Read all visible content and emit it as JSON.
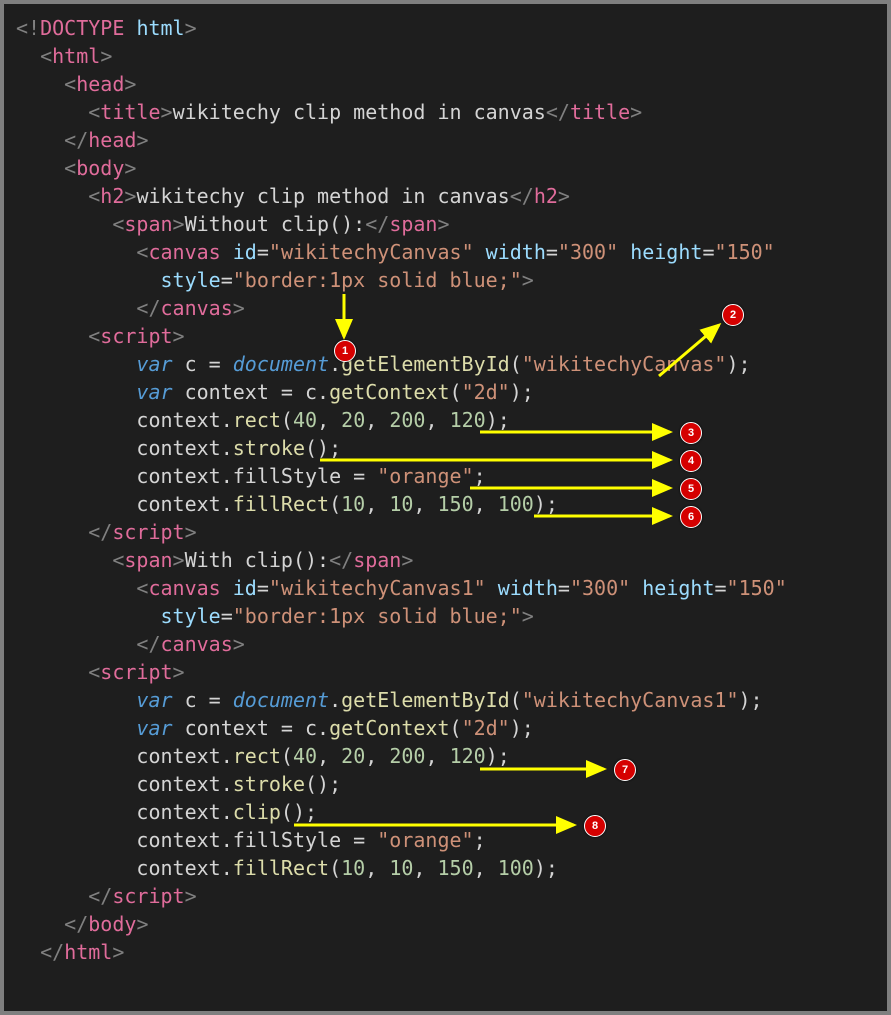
{
  "code_lines": {
    "l1": "<!DOCTYPE html>",
    "l2": "<html>",
    "l3": "<head>",
    "l4a": "<title>",
    "l4b": "wikitechy clip method in canvas",
    "l4c": "</title>",
    "l5": "</head>",
    "l6": "<body>",
    "l7a": "<h2>",
    "l7b": "wikitechy clip method in canvas",
    "l7c": "</h2>",
    "l8a": "<span>",
    "l8b": "Without clip():",
    "l8c": "</span>",
    "l9_tag": "canvas",
    "l9_id": "\"wikitechyCanvas\"",
    "l9_w": "\"300\"",
    "l9_h": "\"150\"",
    "l10_style": "\"border:1px solid blue;\"",
    "l11": "</canvas>",
    "l12": "<script>",
    "l13_var": "var",
    "l13_c": " c = ",
    "l13_doc": "document",
    "l13_fn": "getElementById",
    "l13_arg": "\"wikitechyCanvas\"",
    "l14_var": "var",
    "l14_rest": " context = c.",
    "l14_fn": "getContext",
    "l14_arg": "\"2d\"",
    "l15_pre": "context.",
    "l15_fn": "rect",
    "l15_args": [
      "40",
      "20",
      "200",
      "120"
    ],
    "l16_pre": "context.",
    "l16_fn": "stroke",
    "l17_pre": "context.fillStyle = ",
    "l17_str": "\"orange\"",
    "l18_pre": "context.",
    "l18_fn": "fillRect",
    "l18_args": [
      "10",
      "10",
      "150",
      "100"
    ],
    "l19": "</script>",
    "l20a": "<span>",
    "l20b": "With clip():",
    "l20c": "</span>",
    "l21_tag": "canvas",
    "l21_id": "\"wikitechyCanvas1\"",
    "l21_w": "\"300\"",
    "l21_h": "\"150\"",
    "l22_style": "\"border:1px solid blue;\"",
    "l23": "</canvas>",
    "l24": "<script>",
    "l25_var": "var",
    "l25_c": " c = ",
    "l25_doc": "document",
    "l25_fn": "getElementById",
    "l25_arg": "\"wikitechyCanvas1\"",
    "l26_var": "var",
    "l26_rest": " context = c.",
    "l26_fn": "getContext",
    "l26_arg": "\"2d\"",
    "l27_pre": "context.",
    "l27_fn": "rect",
    "l27_args": [
      "40",
      "20",
      "200",
      "120"
    ],
    "l28_pre": "context.",
    "l28_fn": "stroke",
    "l29_pre": "context.",
    "l29_fn": "clip",
    "l30_pre": "context.fillStyle = ",
    "l30_str": "\"orange\"",
    "l31_pre": "context.",
    "l31_fn": "fillRect",
    "l31_args": [
      "10",
      "10",
      "150",
      "100"
    ],
    "l32": "</script>",
    "l33": "</body>",
    "l34": "</html>"
  },
  "badges": {
    "b1": "1",
    "b2": "2",
    "b3": "3",
    "b4": "4",
    "b5": "5",
    "b6": "6",
    "b7": "7",
    "b8": "8"
  }
}
